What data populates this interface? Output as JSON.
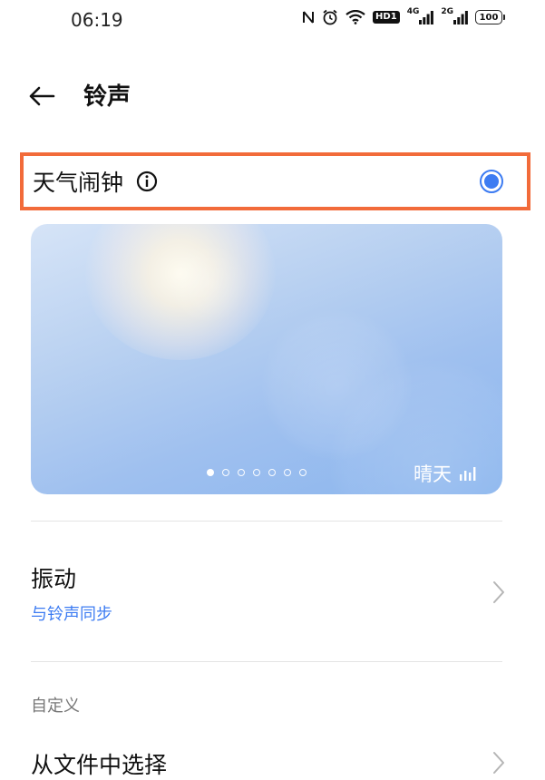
{
  "status_bar": {
    "time": "06:19",
    "hd_label": "HD1",
    "net_4g": "4G",
    "net_2g": "2G",
    "battery": "100"
  },
  "header": {
    "title": "铃声"
  },
  "alarm_option": {
    "label": "天气闹钟",
    "selected": true
  },
  "weather_card": {
    "weather_label": "晴天",
    "page_count": 7,
    "active_page": 1
  },
  "vibrate": {
    "title": "振动",
    "subtitle": "与铃声同步"
  },
  "custom_section": {
    "label": "自定义",
    "from_file": "从文件中选择"
  },
  "colors": {
    "accent": "#3d7cf2",
    "highlight_border": "#f26b3a"
  }
}
